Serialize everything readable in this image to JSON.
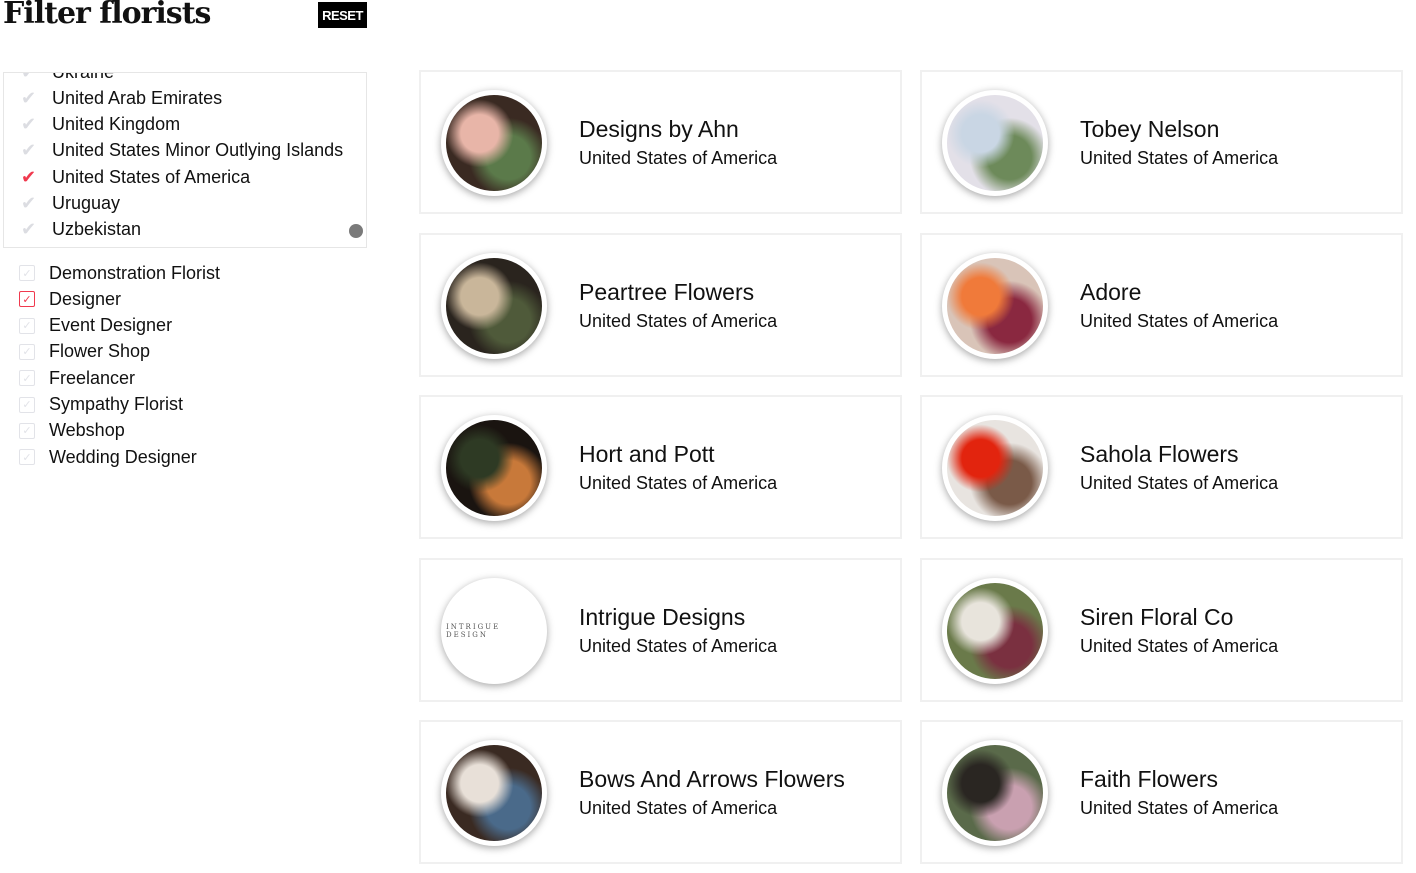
{
  "header": {
    "title": "Filter florists",
    "reset_label": "RESET"
  },
  "countries": [
    {
      "label": "Ukraine",
      "checked": false
    },
    {
      "label": "United Arab Emirates",
      "checked": false
    },
    {
      "label": "United Kingdom",
      "checked": false
    },
    {
      "label": "United States Minor Outlying Islands",
      "checked": false
    },
    {
      "label": "United States of America",
      "checked": true
    },
    {
      "label": "Uruguay",
      "checked": false
    },
    {
      "label": "Uzbekistan",
      "checked": false
    }
  ],
  "types": [
    {
      "label": "Demonstration Florist",
      "checked": false
    },
    {
      "label": "Designer",
      "checked": true
    },
    {
      "label": "Event Designer",
      "checked": false
    },
    {
      "label": "Flower Shop",
      "checked": false
    },
    {
      "label": "Freelancer",
      "checked": false
    },
    {
      "label": "Sympathy Florist",
      "checked": false
    },
    {
      "label": "Webshop",
      "checked": false
    },
    {
      "label": "Wedding Designer",
      "checked": false
    }
  ],
  "florists": [
    {
      "name": "Designs by Ahn",
      "country": "United States of America",
      "colors": [
        "#e8b5a8",
        "#5b7a4a",
        "#3a2a22"
      ]
    },
    {
      "name": "Tobey Nelson",
      "country": "United States of America",
      "colors": [
        "#c9d6e4",
        "#6d8a5a",
        "#e3e0e8"
      ]
    },
    {
      "name": "Peartree Flowers",
      "country": "United States of America",
      "colors": [
        "#c9b69a",
        "#4f5a3a",
        "#2a241e"
      ]
    },
    {
      "name": "Adore",
      "country": "United States of America",
      "colors": [
        "#f07a3a",
        "#8a2840",
        "#d9c4b8"
      ]
    },
    {
      "name": "Hort and Pott",
      "country": "United States of America",
      "colors": [
        "#2e3a24",
        "#c8793a",
        "#1a1410"
      ]
    },
    {
      "name": "Sahola Flowers",
      "country": "United States of America",
      "colors": [
        "#e2240e",
        "#7a5a48",
        "#e8e4e0"
      ]
    },
    {
      "name": "Intrigue Designs",
      "country": "United States of America",
      "logo": "INTRIGUE DESIGN"
    },
    {
      "name": "Siren Floral Co",
      "country": "United States of America",
      "colors": [
        "#e8e4dc",
        "#7a3040",
        "#6a7a4a"
      ]
    },
    {
      "name": "Bows And Arrows Flowers",
      "country": "United States of America",
      "colors": [
        "#e8e0d8",
        "#4a6a8a",
        "#3a2a22"
      ]
    },
    {
      "name": "Faith Flowers",
      "country": "United States of America",
      "colors": [
        "#2a2622",
        "#c9a0b0",
        "#5a6a4a"
      ]
    }
  ]
}
